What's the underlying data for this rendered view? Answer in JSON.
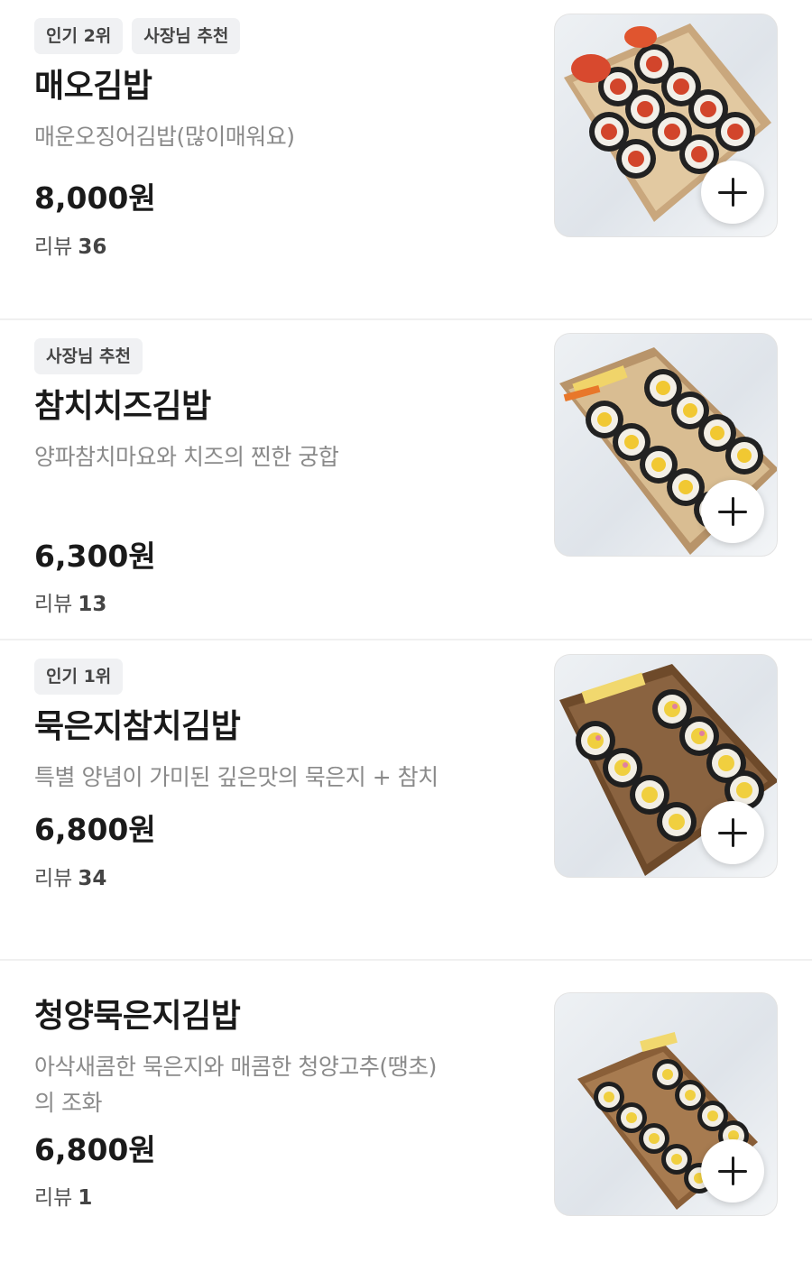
{
  "menu_items": [
    {
      "badges": [
        "인기 2위",
        "사장님 추천"
      ],
      "name": "매오김밥",
      "description": "매운오징어김밥(많이매워요)",
      "price": "8,000원",
      "review_label": "리뷰",
      "review_count": "36",
      "image_icon": "spicy-squid-gimbap-photo"
    },
    {
      "badges": [
        "사장님 추천"
      ],
      "name": "참치치즈김밥",
      "description": "양파참치마요와 치즈의 찐한 궁합",
      "price": "6,300원",
      "review_label": "리뷰",
      "review_count": "13",
      "image_icon": "tuna-cheese-gimbap-photo"
    },
    {
      "badges": [
        "인기 1위"
      ],
      "name": "묵은지참치김밥",
      "description": "특별 양념이 가미된 깊은맛의 묵은지 + 참치",
      "price": "6,800원",
      "review_label": "리뷰",
      "review_count": "34",
      "image_icon": "kimchi-tuna-gimbap-photo"
    },
    {
      "badges": [],
      "name": "청양묵은지김밥",
      "description_line1": "아삭새콤한 묵은지와 매콤한 청양고추(땡초)",
      "description_line2": "의 조화",
      "price": "6,800원",
      "review_label": "리뷰",
      "review_count": "1",
      "image_icon": "cheongyang-kimchi-gimbap-photo"
    }
  ],
  "add_button_icon": "plus-icon",
  "colors": {
    "badge_bg": "#f0f1f3",
    "desc_text": "#8a8a8a",
    "divider": "#f0f0f0",
    "title_text": "#1a1a1a"
  }
}
